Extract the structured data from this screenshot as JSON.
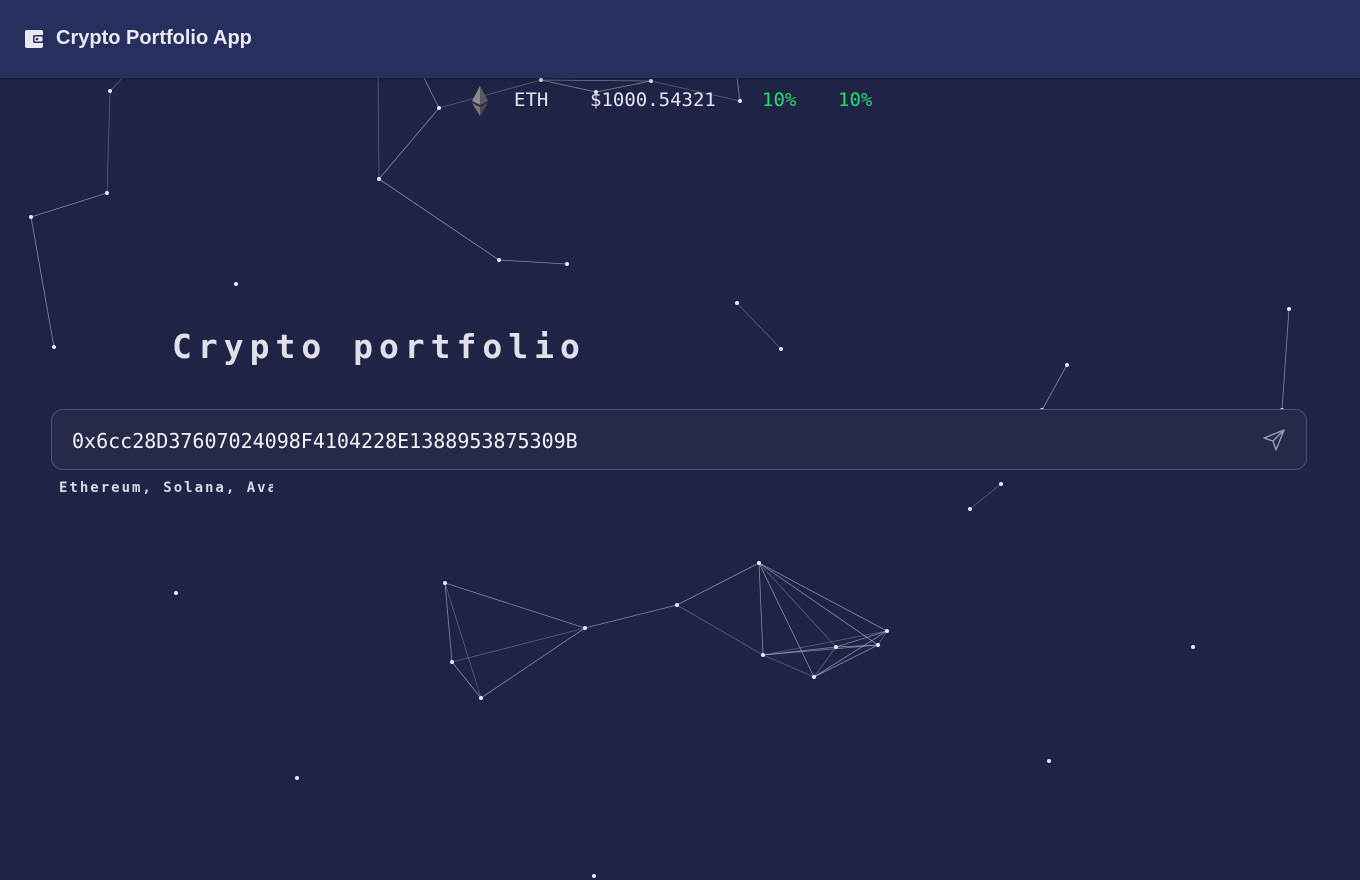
{
  "app": {
    "title": "Crypto Portfolio App",
    "logo_icon": "wallet-icon"
  },
  "ticker": {
    "icon": "ethereum-icon",
    "symbol": "ETH",
    "price": "$1000.54321",
    "change_1": "10%",
    "change_2": "10%",
    "change_color": "#1ee06a"
  },
  "main": {
    "heading": "Crypto portfolio",
    "address_value": "0x6cc28D37607024098F4104228E1388953875309B",
    "send_icon": "send-icon",
    "chains_text": "Ethereum, Solana, Avalanche"
  },
  "colors": {
    "background": "#1f2447",
    "appbar": "#262f5e",
    "input_bg": "#262a48"
  }
}
